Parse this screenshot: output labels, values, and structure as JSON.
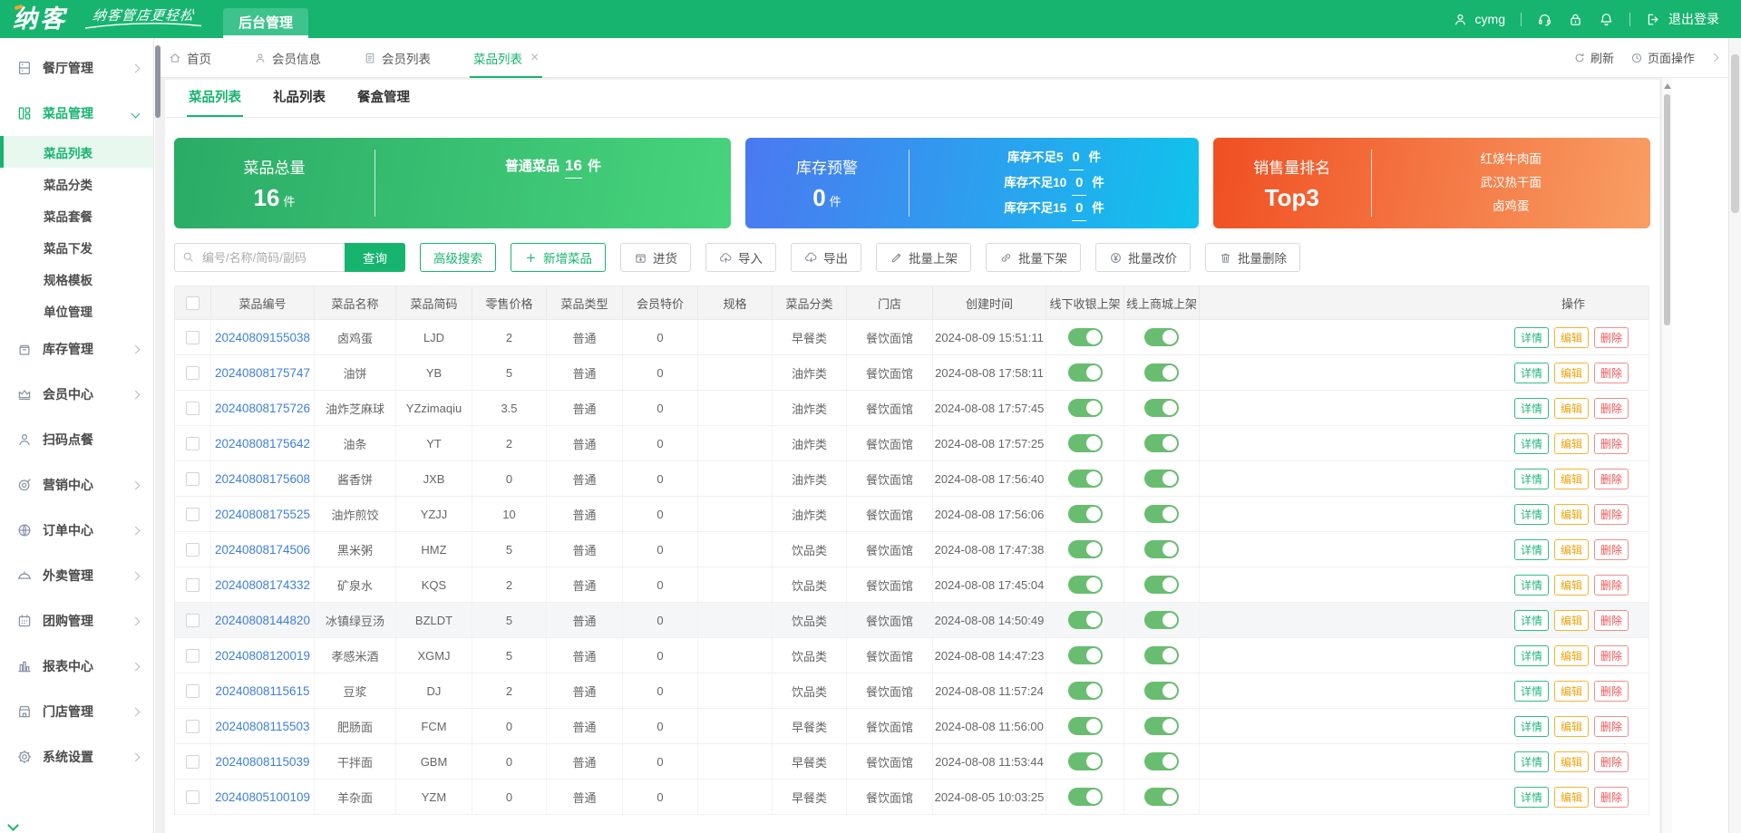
{
  "brand": {
    "logo": "纳客",
    "slogan": "纳客管店更轻松",
    "admin_tab": "后台管理"
  },
  "header": {
    "user": "cymg",
    "logout_label": "退出登录"
  },
  "sidebar": {
    "items": [
      {
        "key": "restaurant",
        "icon": "restaurant",
        "label": "餐厅管理"
      },
      {
        "key": "dish",
        "icon": "dishes",
        "label": "菜品管理",
        "active": true,
        "expanded": true,
        "children": [
          {
            "key": "dish-list",
            "label": "菜品列表",
            "active": true
          },
          {
            "key": "dish-category",
            "label": "菜品分类"
          },
          {
            "key": "dish-combo",
            "label": "菜品套餐"
          },
          {
            "key": "dish-dispatch",
            "label": "菜品下发"
          },
          {
            "key": "spec-template",
            "label": "规格模板"
          },
          {
            "key": "unit-manage",
            "label": "单位管理"
          }
        ]
      },
      {
        "key": "inventory",
        "icon": "inventory",
        "label": "库存管理"
      },
      {
        "key": "member-center",
        "icon": "member",
        "label": "会员中心"
      },
      {
        "key": "scan-order",
        "icon": "scan-order",
        "label": "扫码点餐",
        "expandable": false
      },
      {
        "key": "marketing",
        "icon": "marketing",
        "label": "营销中心"
      },
      {
        "key": "order-center",
        "icon": "order",
        "label": "订单中心"
      },
      {
        "key": "takeout",
        "icon": "takeout",
        "label": "外卖管理"
      },
      {
        "key": "group-buy",
        "icon": "group-buy",
        "label": "团购管理"
      },
      {
        "key": "report",
        "icon": "report",
        "label": "报表中心"
      },
      {
        "key": "store",
        "icon": "store",
        "label": "门店管理"
      },
      {
        "key": "settings",
        "icon": "settings",
        "label": "系统设置"
      }
    ]
  },
  "tabbar": {
    "tabs": [
      {
        "key": "home",
        "icon": "home",
        "label": "首页"
      },
      {
        "key": "member-info",
        "icon": "user",
        "label": "会员信息"
      },
      {
        "key": "member-list",
        "icon": "doc",
        "label": "会员列表"
      },
      {
        "key": "dish-list",
        "label": "菜品列表",
        "active": true,
        "closable": true
      }
    ],
    "refresh_label": "刷新",
    "page_ops_label": "页面操作"
  },
  "subtabs": [
    {
      "key": "dish-list",
      "label": "菜品列表",
      "active": true
    },
    {
      "key": "gift-list",
      "label": "礼品列表"
    },
    {
      "key": "mealbox-manage",
      "label": "餐盒管理"
    }
  ],
  "cards": [
    {
      "key": "dish-total",
      "color": "green",
      "title": "菜品总量",
      "value": "16",
      "unit": "件",
      "lines": [
        {
          "label": "普通菜品",
          "value": "16",
          "unit": "件"
        }
      ]
    },
    {
      "key": "stock-warning",
      "color": "blue",
      "title": "库存预警",
      "value": "0",
      "unit": "件",
      "lines": [
        {
          "label": "库存不足5",
          "value": "0",
          "unit": "件"
        },
        {
          "label": "库存不足10",
          "value": "0",
          "unit": "件"
        },
        {
          "label": "库存不足15",
          "value": "0",
          "unit": "件"
        }
      ]
    },
    {
      "key": "sales-rank",
      "color": "orange",
      "title": "销售量排名",
      "value": "Top3",
      "unit": "",
      "lines": [
        {
          "label": "红烧牛肉面"
        },
        {
          "label": "武汉热干面"
        },
        {
          "label": "卤鸡蛋"
        }
      ]
    }
  ],
  "toolbar": {
    "search_placeholder": "编号/名称/简码/副码",
    "search_button": "查询",
    "buttons": [
      {
        "key": "advanced-search",
        "label": "高级搜索",
        "style": "green-outline"
      },
      {
        "key": "add-dish",
        "label": "新增菜品",
        "icon": "plus",
        "style": "green-outline"
      },
      {
        "key": "purchase",
        "label": "进货",
        "icon": "box-in"
      },
      {
        "key": "import",
        "label": "导入",
        "icon": "cloud-up"
      },
      {
        "key": "export",
        "label": "导出",
        "icon": "cloud-down"
      },
      {
        "key": "batch-on-shelf",
        "label": "批量上架",
        "icon": "pencil"
      },
      {
        "key": "batch-off-shelf",
        "label": "批量下架",
        "icon": "unlink"
      },
      {
        "key": "batch-reprice",
        "label": "批量改价",
        "icon": "yuan"
      },
      {
        "key": "batch-delete",
        "label": "批量删除",
        "icon": "trash"
      }
    ]
  },
  "table": {
    "columns": [
      "",
      "菜品编号",
      "菜品名称",
      "菜品简码",
      "零售价格",
      "菜品类型",
      "会员特价",
      "规格",
      "菜品分类",
      "门店",
      "创建时间",
      "线下收银上架",
      "线上商城上架",
      "操作"
    ],
    "actions": [
      {
        "key": "detail",
        "label": "详情"
      },
      {
        "key": "edit",
        "label": "编辑"
      },
      {
        "key": "delete",
        "label": "删除"
      }
    ],
    "rows": [
      {
        "id": "20240809155038",
        "name": "卤鸡蛋",
        "code": "LJD",
        "price": "2",
        "type": "普通",
        "member_price": "0",
        "spec": "",
        "category": "早餐类",
        "store": "餐饮面馆",
        "created": "2024-08-09 15:51:11",
        "pos_on": true,
        "mall_on": true
      },
      {
        "id": "20240808175747",
        "name": "油饼",
        "code": "YB",
        "price": "5",
        "type": "普通",
        "member_price": "0",
        "spec": "",
        "category": "油炸类",
        "store": "餐饮面馆",
        "created": "2024-08-08 17:58:11",
        "pos_on": true,
        "mall_on": true
      },
      {
        "id": "20240808175726",
        "name": "油炸芝麻球",
        "code": "YZzimaqiu",
        "price": "3.5",
        "type": "普通",
        "member_price": "0",
        "spec": "",
        "category": "油炸类",
        "store": "餐饮面馆",
        "created": "2024-08-08 17:57:45",
        "pos_on": true,
        "mall_on": true
      },
      {
        "id": "20240808175642",
        "name": "油条",
        "code": "YT",
        "price": "2",
        "type": "普通",
        "member_price": "0",
        "spec": "",
        "category": "油炸类",
        "store": "餐饮面馆",
        "created": "2024-08-08 17:57:25",
        "pos_on": true,
        "mall_on": true
      },
      {
        "id": "20240808175608",
        "name": "酱香饼",
        "code": "JXB",
        "price": "0",
        "type": "普通",
        "member_price": "0",
        "spec": "",
        "category": "油炸类",
        "store": "餐饮面馆",
        "created": "2024-08-08 17:56:40",
        "pos_on": true,
        "mall_on": true
      },
      {
        "id": "20240808175525",
        "name": "油炸煎饺",
        "code": "YZJJ",
        "price": "10",
        "type": "普通",
        "member_price": "0",
        "spec": "",
        "category": "油炸类",
        "store": "餐饮面馆",
        "created": "2024-08-08 17:56:06",
        "pos_on": true,
        "mall_on": true
      },
      {
        "id": "20240808174506",
        "name": "黑米粥",
        "code": "HMZ",
        "price": "5",
        "type": "普通",
        "member_price": "0",
        "spec": "",
        "category": "饮品类",
        "store": "餐饮面馆",
        "created": "2024-08-08 17:47:38",
        "pos_on": true,
        "mall_on": true
      },
      {
        "id": "20240808174332",
        "name": "矿泉水",
        "code": "KQS",
        "price": "2",
        "type": "普通",
        "member_price": "0",
        "spec": "",
        "category": "饮品类",
        "store": "餐饮面馆",
        "created": "2024-08-08 17:45:04",
        "pos_on": true,
        "mall_on": true
      },
      {
        "id": "20240808144820",
        "name": "冰镇绿豆汤",
        "code": "BZLDT",
        "price": "5",
        "type": "普通",
        "member_price": "0",
        "spec": "",
        "category": "饮品类",
        "store": "餐饮面馆",
        "created": "2024-08-08 14:50:49",
        "pos_on": true,
        "mall_on": true,
        "hover": true
      },
      {
        "id": "20240808120019",
        "name": "孝感米酒",
        "code": "XGMJ",
        "price": "5",
        "type": "普通",
        "member_price": "0",
        "spec": "",
        "category": "饮品类",
        "store": "餐饮面馆",
        "created": "2024-08-08 14:47:23",
        "pos_on": true,
        "mall_on": true
      },
      {
        "id": "20240808115615",
        "name": "豆浆",
        "code": "DJ",
        "price": "2",
        "type": "普通",
        "member_price": "0",
        "spec": "",
        "category": "饮品类",
        "store": "餐饮面馆",
        "created": "2024-08-08 11:57:24",
        "pos_on": true,
        "mall_on": true
      },
      {
        "id": "20240808115503",
        "name": "肥肠面",
        "code": "FCM",
        "price": "0",
        "type": "普通",
        "member_price": "0",
        "spec": "",
        "category": "早餐类",
        "store": "餐饮面馆",
        "created": "2024-08-08 11:56:00",
        "pos_on": true,
        "mall_on": true
      },
      {
        "id": "20240808115039",
        "name": "干拌面",
        "code": "GBM",
        "price": "0",
        "type": "普通",
        "member_price": "0",
        "spec": "",
        "category": "早餐类",
        "store": "餐饮面馆",
        "created": "2024-08-08 11:53:44",
        "pos_on": true,
        "mall_on": true
      },
      {
        "id": "20240805100109",
        "name": "羊杂面",
        "code": "YZM",
        "price": "0",
        "type": "普通",
        "member_price": "0",
        "spec": "",
        "category": "早餐类",
        "store": "餐饮面馆",
        "created": "2024-08-05 10:03:25",
        "pos_on": true,
        "mall_on": true
      }
    ]
  }
}
